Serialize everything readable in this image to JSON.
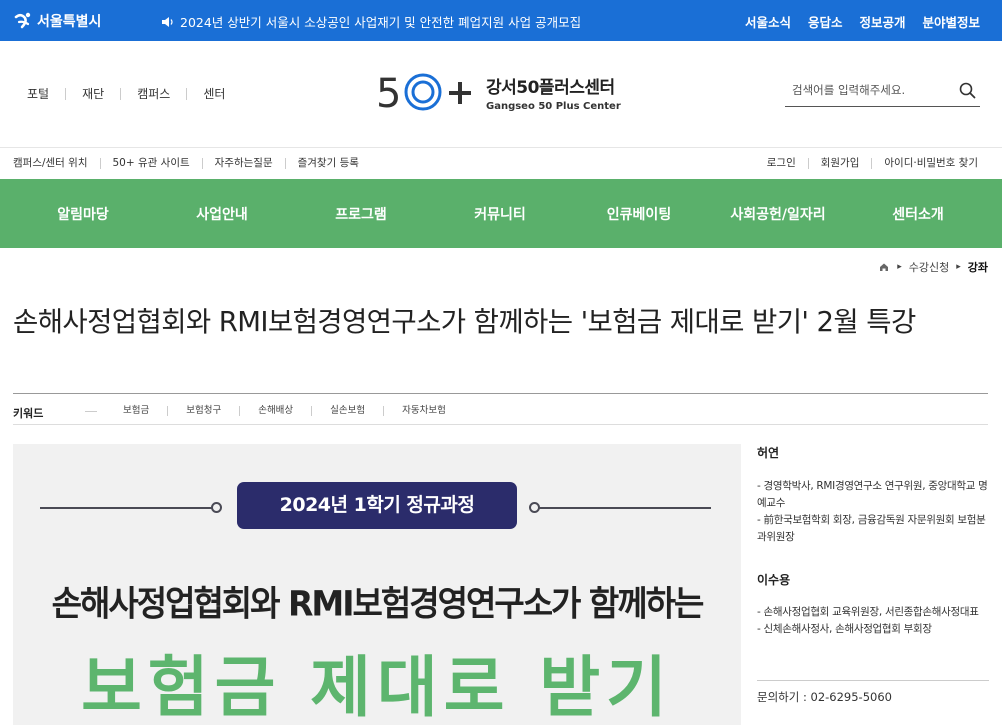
{
  "topbar": {
    "brand": "서울특별시",
    "notice": "2024년 상반기 서울시 소상공인 사업재기 및 안전한 폐업지원 사업 공개모집",
    "links": [
      "서울소식",
      "응답소",
      "정보공개",
      "분야별정보"
    ]
  },
  "header": {
    "util_left": [
      "포털",
      "재단",
      "캠퍼스",
      "센터"
    ],
    "logo_ko": "강서50플러스센터",
    "logo_en": "Gangseo 50 Plus Center",
    "search_placeholder": "검색어를 입력해주세요."
  },
  "subrow": {
    "left": [
      "캠퍼스/센터 위치",
      "50+ 유관 사이트",
      "자주하는질문",
      "즐겨찾기 등록"
    ],
    "right": [
      "로그인",
      "회원가입",
      "아이디·비밀번호 찾기"
    ]
  },
  "gnb": [
    "알림마당",
    "사업안내",
    "프로그램",
    "커뮤니티",
    "인큐베이팅",
    "사회공헌/일자리",
    "센터소개"
  ],
  "breadcrumb": {
    "item1": "수강신청",
    "current": "강좌"
  },
  "page": {
    "title": "손해사정업협회와 RMI보험경영연구소가 함께하는 '보험금 제대로 받기' 2월 특강"
  },
  "keywords": {
    "label": "키워드",
    "items": [
      "보험금",
      "보험청구",
      "손해배상",
      "실손보험",
      "자동차보험"
    ]
  },
  "poster": {
    "badge": "2024년 1학기 정규과정",
    "subtitle": "손해사정업협회와 RMI보험경영연구소가 함께하는",
    "headline": "보험금 제대로 받기"
  },
  "instructors": [
    {
      "name": "허연",
      "lines": [
        "- 경영학박사, RMI경영연구소 연구위원, 중앙대학교 명예교수",
        "- 前한국보험학회 회장, 금융감독원 자문위원회 보험분과위원장"
      ]
    },
    {
      "name": "이수용",
      "lines": [
        "- 손해사정업협회 교육위원장, 서린종합손해사정대표",
        "- 신체손해사정사, 손해사정업협회 부회장"
      ]
    }
  ],
  "contact": "문의하기 : 02-6295-5060",
  "colors": {
    "topbar": "#1a6fd6",
    "gnb": "#5ab06b",
    "poster_badge": "#2b2c6b",
    "poster_headline": "#5db56e"
  }
}
